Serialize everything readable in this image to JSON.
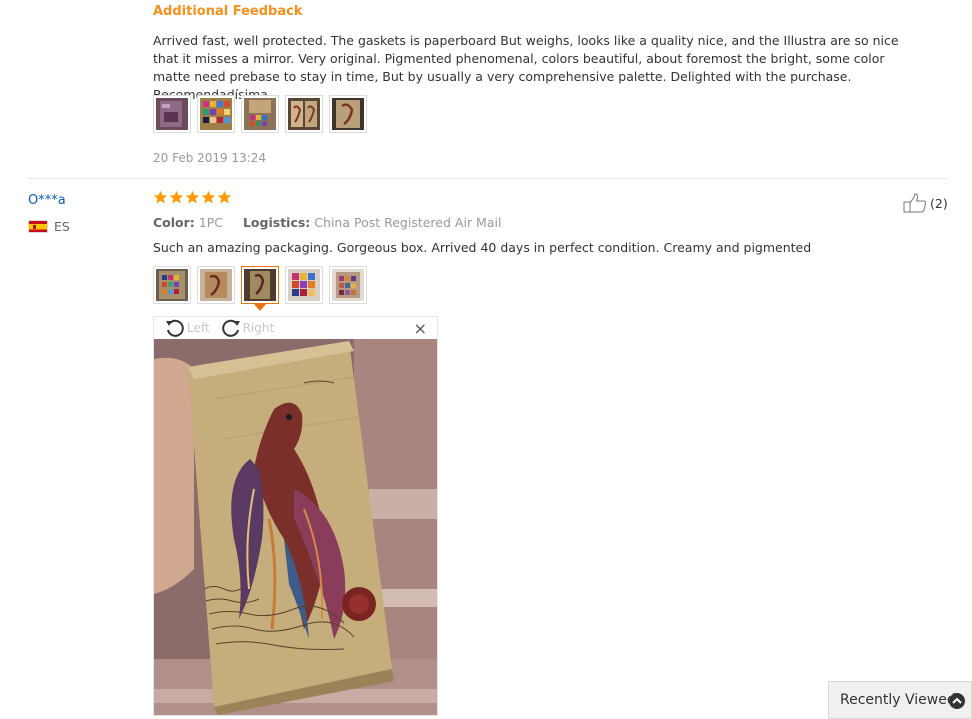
{
  "first_review": {
    "additional_feedback_title": "Additional Feedback",
    "text": "Arrived fast, well protected. The gaskets is paperboard But weighs, looks like a quality nice, and the Illustra are so nice that it misses a mirror. Very original. Pigmented phenomenal, colors beautiful, about foremost the bright, some color matte need prebase to stay in time, But by usually a very comprehensive palette. Delighted with the purchase. Recomendadísima.",
    "thumbnail_count": 5,
    "date": "20 Feb 2019 13:24"
  },
  "second_review": {
    "user_name": "O***a",
    "country_code": "ES",
    "rating_stars": 5,
    "color_label": "Color:",
    "color_value": "1PC",
    "logistics_label": "Logistics:",
    "logistics_value": "China Post Registered Air Mail",
    "text": "Such an amazing packaging. Gorgeous box. Arrived 40 days in perfect condition. Creamy and pigmented",
    "helpful_count": "(2)",
    "thumbnail_count": 5,
    "active_thumbnail_index": 2
  },
  "viewer": {
    "rotate_left_label": "Left",
    "rotate_right_label": "Right",
    "close_symbol": "×"
  },
  "recently_viewed": {
    "label": "Recently Viewed"
  },
  "colors": {
    "accent_orange": "#f3911c",
    "link_blue": "#0a5dbd",
    "star_orange": "#ff9a00",
    "meta_grey": "#999999"
  },
  "icons": {
    "rotate_left": "rotate-left-icon",
    "rotate_right": "rotate-right-icon",
    "close": "close-icon",
    "thumbs_up": "thumbs-up-icon",
    "star": "star-icon",
    "flag": "flag-es-icon",
    "chevron_up": "chevron-up-icon"
  }
}
